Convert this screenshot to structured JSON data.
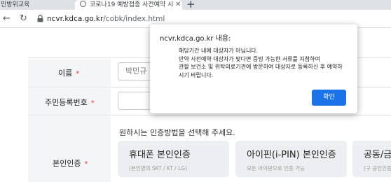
{
  "browser": {
    "tabs": [
      {
        "label": "민방위교육",
        "active": false
      },
      {
        "label": "코로나19 예방접종 사전예약 시",
        "active": true
      }
    ],
    "url_host": "ncvr.kdca.go.kr",
    "url_path": "/cobk/index.html"
  },
  "form": {
    "name_label": "이름",
    "name_value": "박민규",
    "rrn_label": "주민등록번호",
    "required_mark": "*",
    "auth_label": "본인인증",
    "auth_instruction": "원하시는 인증방법을 선택해 주세요.",
    "auth_options": [
      {
        "title": "휴대폰 본인인증",
        "subtitle": "(본인명의 SKT / KT / LG)"
      },
      {
        "title": "아이핀(i-PIN) 본인인증",
        "subtitle": "모든 아이핀으로 인증 가능"
      },
      {
        "title": "공동/금융",
        "subtitle": "(구 공인인증"
      }
    ]
  },
  "dialog": {
    "title": "ncvr.kdca.go.kr 내용:",
    "message_lines": [
      "해당기간 내에 대상자가 아닙니다.",
      "만약 사전예약 대상자가 맞다면 증빙 가능한 서류를 지참하여",
      "관할 보건소 및 위탁의료기관에 방문하여 대상자로 등록하신 후 예약하",
      "시기 바랍니다."
    ],
    "ok_label": "확인"
  },
  "colors": {
    "dialog_button": "#1a73e8",
    "required": "#e23b3b"
  }
}
